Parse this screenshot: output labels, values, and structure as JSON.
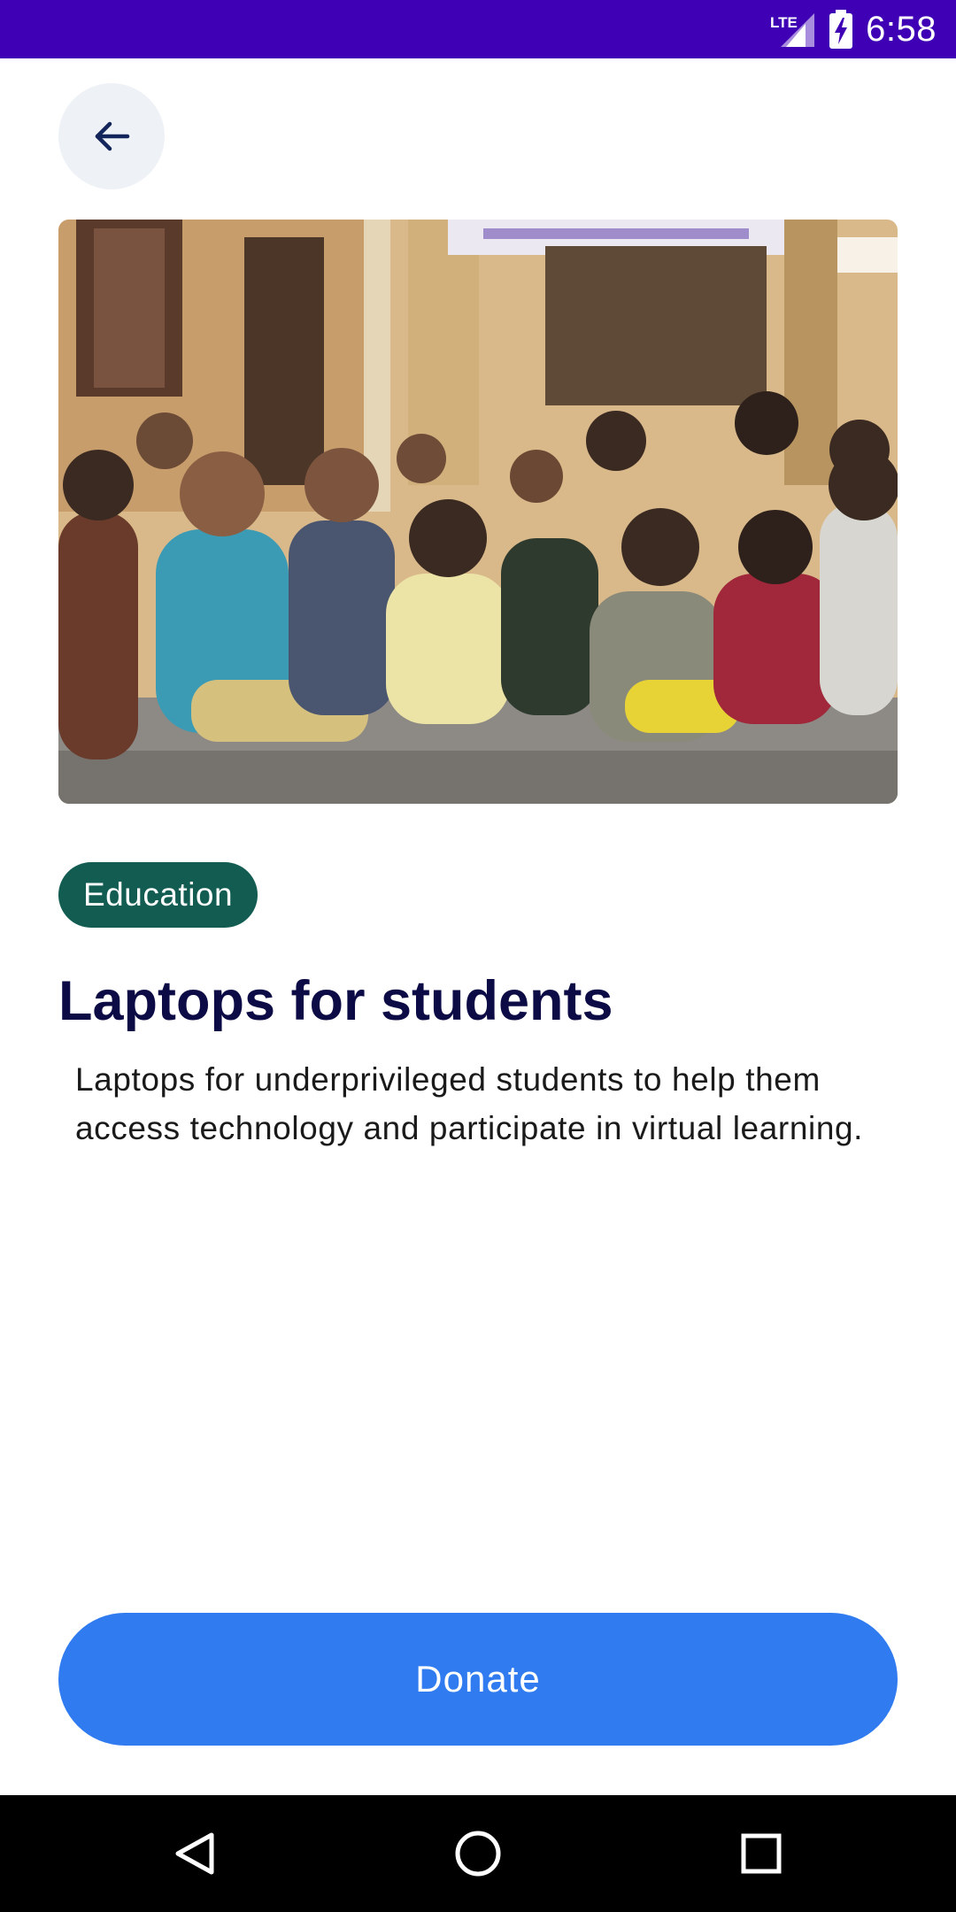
{
  "status_bar": {
    "network_label": "LTE",
    "time": "6:58",
    "icons": [
      "lte-signal-icon",
      "battery-charging-icon"
    ]
  },
  "nav": {
    "back_icon": "arrow-left-icon"
  },
  "hero": {
    "alt": "Children sitting on the floor in a classroom"
  },
  "project": {
    "category": "Education",
    "title": "Laptops for students",
    "description": "Laptops for underprivileged students to help them access technology and participate in virtual learning."
  },
  "actions": {
    "donate_label": "Donate"
  },
  "system_nav": {
    "icons": [
      "back-triangle-icon",
      "home-circle-icon",
      "recents-square-icon"
    ]
  },
  "colors": {
    "status_bar": "#3f00b5",
    "tag_bg": "#135c52",
    "title": "#0c0b45",
    "primary": "#2f7bef"
  }
}
